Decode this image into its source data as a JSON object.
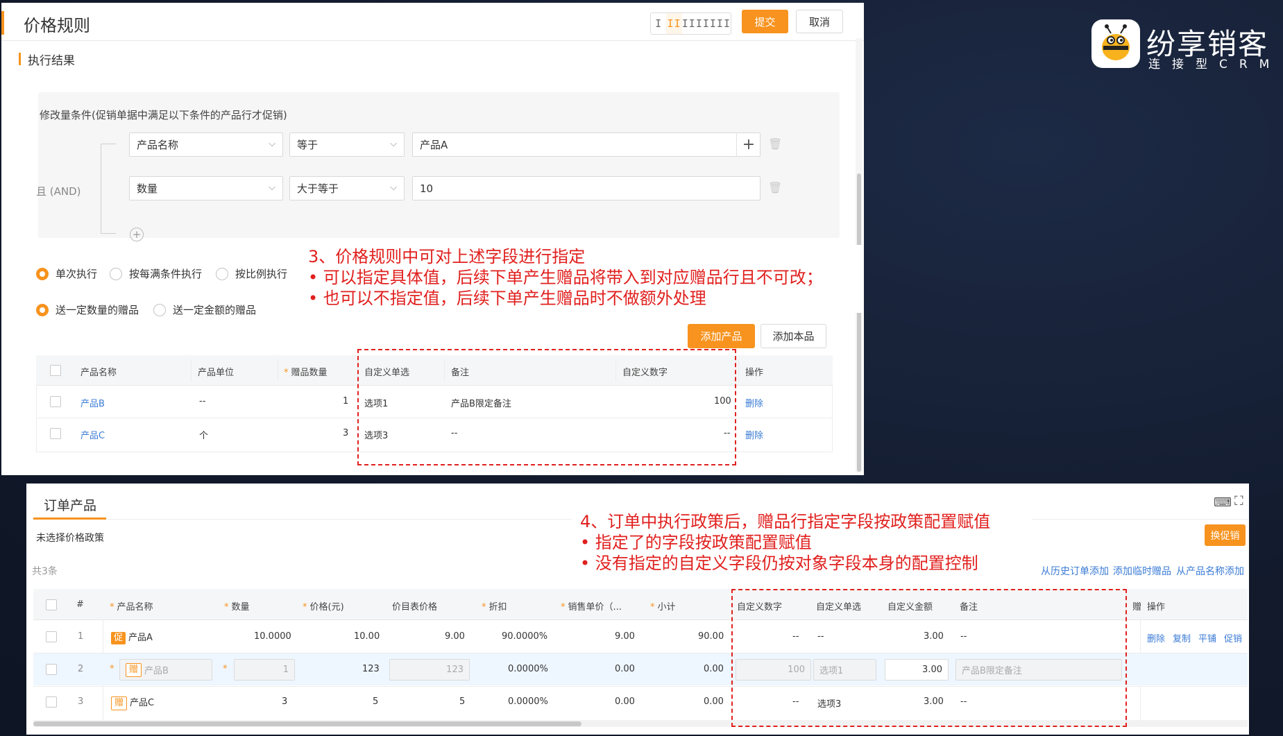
{
  "top": {
    "title": "价格规则",
    "layout_buttons": [
      "I",
      "II",
      "III",
      "IIII"
    ],
    "submit": "提交",
    "cancel": "取消",
    "section": "执行结果",
    "condition_title": "修改量条件(促销单据中满足以下条件的产品行才促销)",
    "and_label": "且 (AND)",
    "conditions": [
      {
        "field": "产品名称",
        "op": "等于",
        "value": "产品A"
      },
      {
        "field": "数量",
        "op": "大于等于",
        "value": "10"
      }
    ],
    "exec_radios": [
      "单次执行",
      "按每满条件执行",
      "按比例执行"
    ],
    "gift_radios": [
      "送一定数量的赠品",
      "送一定金额的赠品"
    ],
    "add_product": "添加产品",
    "add_self": "添加本品",
    "columns": [
      "产品名称",
      "产品单位",
      "赠品数量",
      "自定义单选",
      "备注",
      "自定义数字",
      "操作"
    ],
    "rows": [
      {
        "name": "产品B",
        "unit": "--",
        "qty": "1",
        "single": "选项1",
        "note": "产品B限定备注",
        "num": "100",
        "op": "删除"
      },
      {
        "name": "产品C",
        "unit": "个",
        "qty": "3",
        "single": "选项3",
        "note": "--",
        "num": "--",
        "op": "删除"
      }
    ]
  },
  "callout1": {
    "line1": "3、价格规则中可对上述字段进行指定",
    "line2": "•   可以指定具体值，后续下单产生赠品将带入到对应赠品行且不可改；",
    "line3": "•   也可以不指定值，后续下单产生赠品时不做额外处理"
  },
  "brand": {
    "name": "纷享销客",
    "sub": "连接型CRM"
  },
  "bottom": {
    "title": "订单产品",
    "no_policy": "未选择价格政策",
    "total": "共3条",
    "change_promo": "换促销",
    "links": [
      "从历史订单添加",
      "添加临时赠品",
      "从产品名称添加"
    ],
    "columns": [
      "#",
      "产品名称",
      "数量",
      "价格(元)",
      "价目表价格",
      "折扣",
      "销售单价（...",
      "小计",
      "自定义数字",
      "自定义单选",
      "自定义金额",
      "备注",
      "赠",
      "操作"
    ],
    "rows": [
      {
        "idx": "1",
        "tag": "促",
        "name": "产品A",
        "qty": "10.0000",
        "price": "10.00",
        "list": "9.00",
        "disc": "90.0000%",
        "unit": "9.00",
        "sub": "90.00",
        "cnum": "--",
        "csingle": "--",
        "camt": "3.00",
        "note": "--",
        "ops": [
          "删除",
          "复制",
          "平铺",
          "促销"
        ]
      },
      {
        "idx": "2",
        "tag": "赠",
        "name": "产品B",
        "qty": "1",
        "price": "123",
        "list": "123",
        "disc": "0.0000%",
        "unit": "0.00",
        "sub": "0.00",
        "cnum": "100",
        "csingle": "选项1",
        "camt": "3.00",
        "note": "产品B限定备注",
        "ops": []
      },
      {
        "idx": "3",
        "tag": "赠",
        "name": "产品C",
        "qty": "3",
        "price": "5",
        "list": "5",
        "disc": "0.0000%",
        "unit": "0.00",
        "sub": "0.00",
        "cnum": "--",
        "csingle": "选项3",
        "camt": "3.00",
        "note": "--",
        "ops": []
      }
    ]
  },
  "callout2": {
    "line1": "4、订单中执行政策后，赠品行指定字段按政策配置赋值",
    "line2": "•   指定了的字段按政策配置赋值",
    "line3": "•   没有指定的自定义字段仍按对象字段本身的配置控制"
  },
  "colors": {
    "accent": "#f7931e",
    "link": "#3a7bd5",
    "annotation": "#e0201e"
  }
}
